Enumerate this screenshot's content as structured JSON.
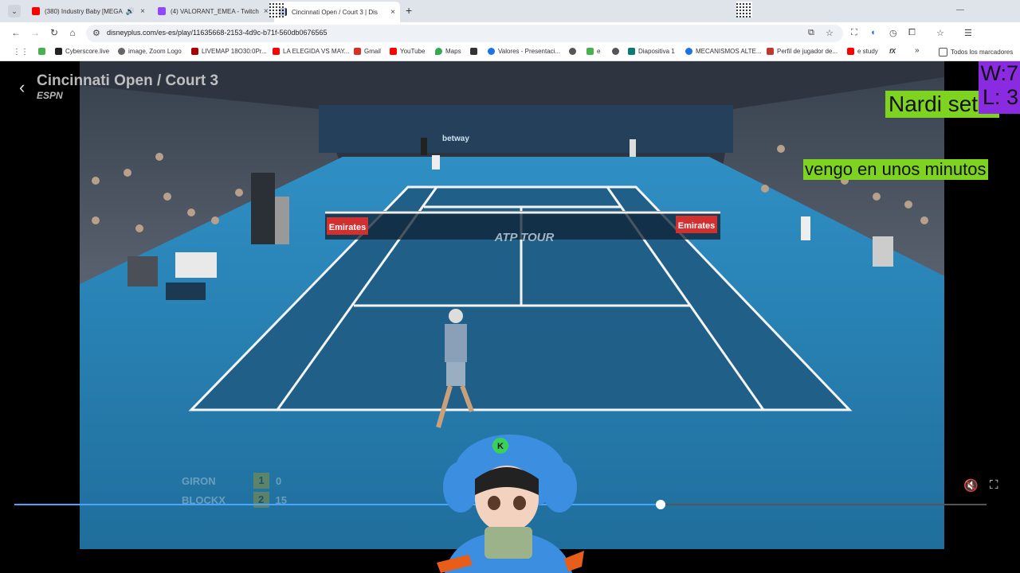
{
  "browser": {
    "tabs": [
      {
        "title": "(380) Industry Baby [MEGA",
        "favicon_color": "#ff0000",
        "icon": "youtube-icon",
        "audio": "🔊"
      },
      {
        "title": "(4) VALORANT_EMEA - Twitch",
        "favicon_color": "#9146ff",
        "icon": "twitch-icon"
      },
      {
        "title": "Cincinnati Open / Court 3 | Dis",
        "favicon_color": "#1c2a5e",
        "icon": "disney-icon",
        "active": true
      }
    ],
    "url": "disneyplus.com/es-es/play/11635668-2153-4d9c-b71f-560db0676565",
    "bookmarks": [
      {
        "label": "",
        "color": "#4caf50"
      },
      {
        "label": "Cyberscore.live",
        "color": "#222"
      },
      {
        "label": "image, Zoom Logo",
        "color": "#666"
      },
      {
        "label": "LIVEMAP 18O30:0Pr...",
        "color": "#a00"
      },
      {
        "label": "LA ELEGIDA VS MAY...",
        "color": "#ff0000"
      },
      {
        "label": "Gmail",
        "color": "#d93025"
      },
      {
        "label": "YouTube",
        "color": "#ff0000"
      },
      {
        "label": "Maps",
        "color": "#34a853"
      },
      {
        "label": "",
        "color": "#333"
      },
      {
        "label": "Valores - Presentaci...",
        "color": "#1a73e8"
      },
      {
        "label": "",
        "color": "#555"
      },
      {
        "label": "e",
        "color": "#4caf50"
      },
      {
        "label": "",
        "color": "#555"
      },
      {
        "label": "Diapositiva 1",
        "color": "#0b7a75"
      },
      {
        "label": "MECANISMOS ALTE...",
        "color": "#1a73e8"
      },
      {
        "label": "Perfil de jugador de...",
        "color": "#c0392b"
      },
      {
        "label": "e study",
        "color": "#ff0000"
      },
      {
        "label": "fX",
        "color": "#222"
      },
      {
        "label": "Todos los marcadores",
        "color": "#555"
      }
    ]
  },
  "video": {
    "title": "Cincinnati Open / Court 3",
    "network": "ESPN",
    "progress": 0.665,
    "scoreboard": [
      {
        "player": "GIRON",
        "sets": "1",
        "games": "0",
        "serving": true
      },
      {
        "player": "BLOCKX",
        "sets": "2",
        "games": "15",
        "serving": false
      }
    ],
    "banner_left": "Emirates",
    "banner_right": "Emirates",
    "net_logo": "ATP TOUR",
    "sponsor": "betway"
  },
  "overlays": {
    "nardi": "Nardi set 2",
    "vengo": "vengo en unos minutos",
    "win_loss_w": "W:7",
    "win_loss_l": "L: 3"
  },
  "colors": {
    "court": "#1d6fa0",
    "court_outer": "#2a86b8",
    "overlay_green": "#7ed321",
    "overlay_purple": "#8a2be2",
    "progress": "#4aa3ff"
  }
}
